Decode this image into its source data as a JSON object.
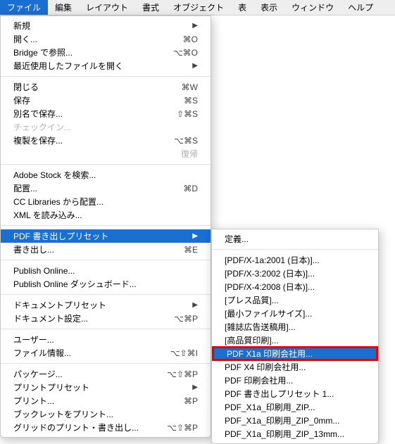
{
  "menubar": [
    "ファイル",
    "編集",
    "レイアウト",
    "書式",
    "オブジェクト",
    "表",
    "表示",
    "ウィンドウ",
    "ヘルプ"
  ],
  "menubar_active_index": 0,
  "main": {
    "groups": [
      [
        {
          "label": "新規",
          "arrow": true
        },
        {
          "label": "開く...",
          "shortcut": "⌘O"
        },
        {
          "label": "Bridge で参照...",
          "shortcut": "⌥⌘O"
        },
        {
          "label": "最近使用したファイルを開く",
          "arrow": true
        }
      ],
      [
        {
          "label": "閉じる",
          "shortcut": "⌘W"
        },
        {
          "label": "保存",
          "shortcut": "⌘S"
        },
        {
          "label": "別名で保存...",
          "shortcut": "⇧⌘S"
        },
        {
          "label": "チェックイン...",
          "disabled": true
        },
        {
          "label": "複製を保存...",
          "shortcut": "⌥⌘S"
        },
        {
          "label": "復帰",
          "disabled": true,
          "right": true
        }
      ],
      [
        {
          "label": "Adobe Stock を検索..."
        },
        {
          "label": "配置...",
          "shortcut": "⌘D"
        },
        {
          "label": "CC Libraries から配置..."
        },
        {
          "label": "XML を読み込み..."
        }
      ],
      [
        {
          "label": "PDF 書き出しプリセット",
          "arrow": true,
          "highlighted": true
        },
        {
          "label": "書き出し...",
          "shortcut": "⌘E"
        }
      ],
      [
        {
          "label": "Publish Online..."
        },
        {
          "label": "Publish Online ダッシュボード..."
        }
      ],
      [
        {
          "label": "ドキュメントプリセット",
          "arrow": true
        },
        {
          "label": "ドキュメント設定...",
          "shortcut": "⌥⌘P"
        }
      ],
      [
        {
          "label": "ユーザー..."
        },
        {
          "label": "ファイル情報...",
          "shortcut": "⌥⇧⌘I"
        }
      ],
      [
        {
          "label": "パッケージ...",
          "shortcut": "⌥⇧⌘P"
        },
        {
          "label": "プリントプリセット",
          "arrow": true
        },
        {
          "label": "プリント...",
          "shortcut": "⌘P"
        },
        {
          "label": "ブックレットをプリント..."
        },
        {
          "label": "グリッドのプリント・書き出し...",
          "shortcut": "⌥⇧⌘P"
        }
      ]
    ]
  },
  "sub": {
    "groups": [
      [
        {
          "label": "定義..."
        }
      ],
      [
        {
          "label": "[PDF/X-1a:2001 (日本)]..."
        },
        {
          "label": "[PDF/X-3:2002 (日本)]..."
        },
        {
          "label": "[PDF/X-4:2008 (日本)]..."
        },
        {
          "label": "[プレス品質]..."
        },
        {
          "label": "[最小ファイルサイズ]..."
        },
        {
          "label": "[雑誌広告送稿用]..."
        },
        {
          "label": "[高品質印刷]..."
        },
        {
          "label": "PDF X1a 印刷会社用...",
          "highlighted": true,
          "boxed": true
        },
        {
          "label": "PDF X4 印刷会社用..."
        },
        {
          "label": "PDF 印刷会社用..."
        },
        {
          "label": "PDF 書き出しプリセット 1..."
        },
        {
          "label": "PDF_X1a_印刷用_ZIP..."
        },
        {
          "label": "PDF_X1a_印刷用_ZIP_0mm..."
        },
        {
          "label": "PDF_X1a_印刷用_ZIP_13mm..."
        }
      ]
    ]
  }
}
